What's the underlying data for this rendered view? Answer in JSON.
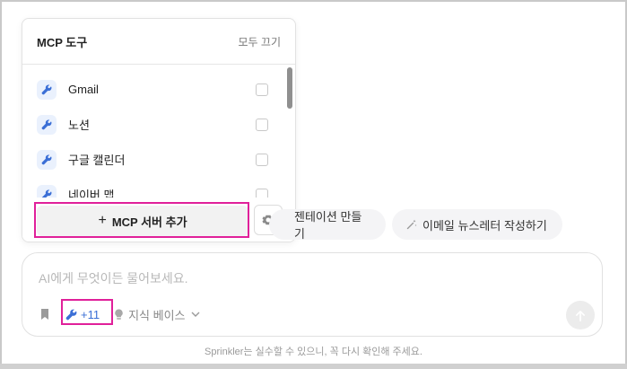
{
  "mcp_panel": {
    "title": "MCP 도구",
    "turn_off_all": "모두 끄기",
    "tools": [
      {
        "label": "Gmail",
        "checked": false,
        "icon": "wrench-icon"
      },
      {
        "label": "노션",
        "checked": false,
        "icon": "wrench-icon"
      },
      {
        "label": "구글 캘린더",
        "checked": false,
        "icon": "wrench-icon"
      },
      {
        "label": "네이버 맵",
        "checked": false,
        "icon": "wrench-icon"
      }
    ],
    "add_server_label": "MCP 서버 추가",
    "settings_icon": "gear-icon"
  },
  "suggestions": {
    "chip1": "젠테이션 만들기",
    "chip2": "이메일 뉴스레터 작성하기"
  },
  "composer": {
    "placeholder": "AI에게 무엇이든 물어보세요.",
    "tools_count": "+11",
    "knowledge_base": "지식 베이스"
  },
  "disclaimer": "Sprinkler는 실수할 수 있으니, 꼭 다시 확인해 주세요.",
  "colors": {
    "accent": "#3b6fd6",
    "highlight": "#e0209a",
    "tool_icon_bg": "#eaf1fd"
  }
}
